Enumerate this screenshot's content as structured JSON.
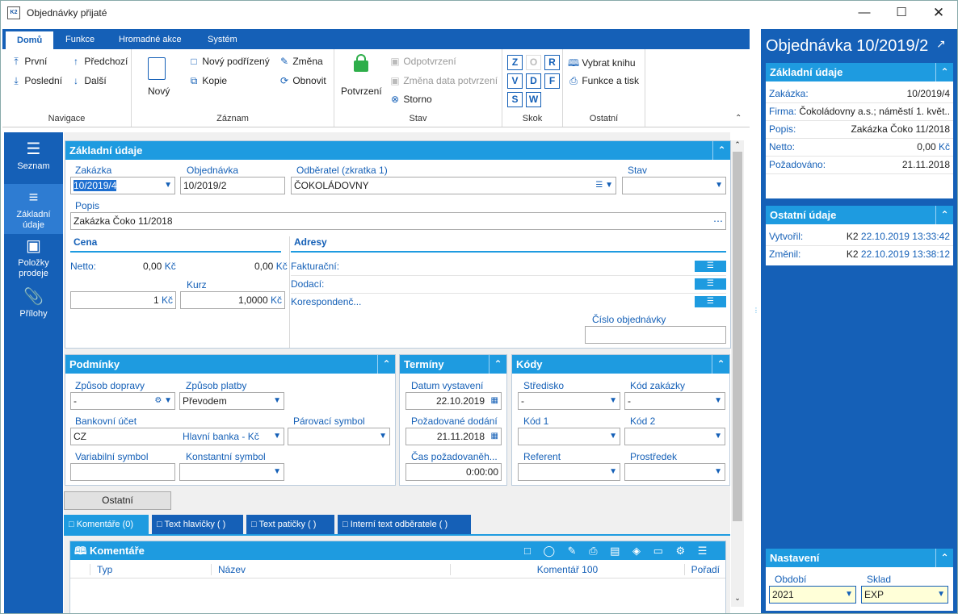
{
  "window": {
    "title": "Objednávky přijaté",
    "app_badge": "K2"
  },
  "ribbon": {
    "tabs": [
      {
        "label": "Domů"
      },
      {
        "label": "Funkce"
      },
      {
        "label": "Hromadné akce"
      },
      {
        "label": "Systém"
      }
    ],
    "nav": {
      "first": "První",
      "last": "Poslední",
      "prev": "Předchozí",
      "next": "Další",
      "group": "Navigace"
    },
    "record": {
      "new": "Nový",
      "new_child": "Nový podřízený",
      "change": "Změna",
      "copy": "Kopie",
      "refresh": "Obnovit",
      "group": "Záznam"
    },
    "state": {
      "confirm": "Potvrzení",
      "unconfirm": "Odpotvrzení",
      "change_date": "Změna data potvrzení",
      "storno": "Storno",
      "group": "Stav"
    },
    "skok": {
      "letters": [
        "Z",
        "O",
        "R",
        "V",
        "D",
        "F",
        "S",
        "W"
      ],
      "group": "Skok"
    },
    "other": {
      "choose_book": "Vybrat knihu",
      "print": "Funkce a tisk",
      "group": "Ostatní"
    }
  },
  "leftnav": {
    "items": [
      {
        "label": "Seznam"
      },
      {
        "label": "Základní údaje"
      },
      {
        "label": "Položky prodeje"
      },
      {
        "label": "Přílohy"
      }
    ]
  },
  "basic": {
    "title": "Základní údaje",
    "zakazka_label": "Zakázka",
    "zakazka": "10/2019/4",
    "objednavka_label": "Objednávka",
    "objednavka": "10/2019/2",
    "odberatel_label": "Odběratel (zkratka 1)",
    "odberatel": "ČOKOLÁDOVNY",
    "stav_label": "Stav",
    "stav": "",
    "popis_label": "Popis",
    "popis": "Zakázka Čoko 11/2018",
    "cena_head": "Cena",
    "netto_label": "Netto:",
    "netto1": "0,00",
    "netto1_cur": "Kč",
    "netto2": "0,00",
    "netto2_cur": "Kč",
    "kurz_label": "Kurz",
    "amount": "1",
    "amount_cur": "Kč",
    "kurz": "1,0000",
    "kurz_cur": "Kč",
    "adresy_head": "Adresy",
    "fakt": "Fakturační:",
    "dod": "Dodací:",
    "kor": "Korespondenč...",
    "cislo_obj_label": "Číslo objednávky",
    "cislo_obj": ""
  },
  "podminky": {
    "title": "Podmínky",
    "doprava_label": "Způsob dopravy",
    "doprava": "-",
    "platba_label": "Způsob platby",
    "platba": "Převodem",
    "ucet_label": "Bankovní účet",
    "ucet": "CZ",
    "ucet_bank": "Hlavní banka - Kč",
    "parovaci_label": "Párovací symbol",
    "vs_label": "Variabilní symbol",
    "ks_label": "Konstantní symbol"
  },
  "terminy": {
    "title": "Termíny",
    "vyst_label": "Datum vystavení",
    "vyst": "22.10.2019",
    "dodani_label": "Požadované dodání",
    "dodani": "21.11.2018",
    "cas_label": "Čas požadovaněh...",
    "cas": "0:00:00"
  },
  "kody": {
    "title": "Kódy",
    "stredisko_label": "Středisko",
    "stredisko": "-",
    "kod_zak_label": "Kód zakázky",
    "kod_zak": "-",
    "kod1_label": "Kód 1",
    "kod2_label": "Kód 2",
    "referent_label": "Referent",
    "prostredek_label": "Prostředek"
  },
  "ostatni_btn": "Ostatní",
  "bottom_tabs": [
    {
      "label": "Komentáře (0)"
    },
    {
      "label": "Text hlavičky ( )"
    },
    {
      "label": "Text patičky ( )"
    },
    {
      "label": "Interní text odběratele ( )"
    }
  ],
  "komentare": {
    "title": "Komentáře",
    "cols": [
      "Typ",
      "Název",
      "Komentář 100",
      "Pořadí"
    ]
  },
  "right": {
    "title": "Objednávka 10/2019/2",
    "basic_head": "Základní údaje",
    "rows": [
      {
        "k": "Zakázka:",
        "v": "10/2019/4"
      },
      {
        "k": "Firma:",
        "v": "Čokoládovny a.s.; náměstí 1. květ..."
      },
      {
        "k": "Popis:",
        "v": "Zakázka Čoko 11/2018"
      },
      {
        "k": "Netto:",
        "v": "0,00",
        "cur": "Kč"
      },
      {
        "k": "Požadováno:",
        "v": "21.11.2018"
      }
    ],
    "other_head": "Ostatní údaje",
    "created_label": "Vytvořil:",
    "created_user": "K2",
    "created_at": "22.10.2019 13:33:42",
    "changed_label": "Změnil:",
    "changed_user": "K2",
    "changed_at": "22.10.2019 13:38:12",
    "settings_head": "Nastavení",
    "obdobi_label": "Období",
    "obdobi": "2021",
    "sklad_label": "Sklad",
    "sklad": "EXP"
  }
}
